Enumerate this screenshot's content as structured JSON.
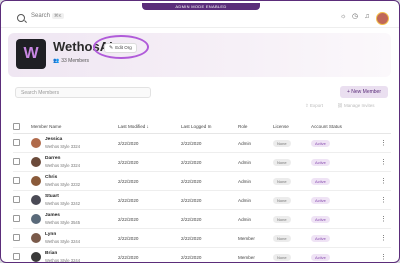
{
  "admin_badge": "ADMIN MODE ENABLED",
  "topbar": {
    "search_label": "Search",
    "search_shortcut": "⌘K",
    "icons": [
      "sun-icon",
      "clock-icon",
      "bell-icon",
      "avatar"
    ]
  },
  "org": {
    "name": "WethosAI",
    "edit_label": "Edit Org",
    "members_count": "33 Members",
    "logo_color": "#c987e3"
  },
  "search_members_placeholder": "Search Members",
  "new_member_label": "+ New Member",
  "export_label": "Export",
  "manage_invites_label": "Manage Invites",
  "table": {
    "headers": [
      "Member Name",
      "Last Modified",
      "Last Logged In",
      "Role",
      "License",
      "Account Status"
    ],
    "rows": [
      {
        "name": "Jessica",
        "subtitle": "Wethos Style 3324",
        "modified": "2/22/2020",
        "logged": "2/22/2020",
        "role": "Admin",
        "license": "None",
        "status": "Active",
        "avatar": "#b06a4a"
      },
      {
        "name": "Darren",
        "subtitle": "Wethos Style 3324",
        "modified": "2/22/2020",
        "logged": "2/22/2020",
        "role": "Admin",
        "license": "None",
        "status": "Active",
        "avatar": "#6b4a3a"
      },
      {
        "name": "Chris",
        "subtitle": "Wethos Style 3232",
        "modified": "2/22/2020",
        "logged": "2/22/2020",
        "role": "Admin",
        "license": "None",
        "status": "Active",
        "avatar": "#8a5a3a"
      },
      {
        "name": "Stuart",
        "subtitle": "Wethos Style 3242",
        "modified": "2/22/2020",
        "logged": "2/22/2020",
        "role": "Admin",
        "license": "None",
        "status": "Active",
        "avatar": "#4a4a55"
      },
      {
        "name": "James",
        "subtitle": "Wethos Style 3545",
        "modified": "2/22/2020",
        "logged": "2/22/2020",
        "role": "Admin",
        "license": "None",
        "status": "Active",
        "avatar": "#5a6a7a"
      },
      {
        "name": "Lynn",
        "subtitle": "Wethos Style 3244",
        "modified": "2/22/2020",
        "logged": "2/22/2020",
        "role": "Member",
        "license": "None",
        "status": "Active",
        "avatar": "#7a5a4a"
      },
      {
        "name": "Brian",
        "subtitle": "Wethos Style 3244",
        "modified": "2/22/2020",
        "logged": "2/22/2020",
        "role": "Member",
        "license": "None",
        "status": "Active",
        "avatar": "#3a3a3a"
      }
    ]
  }
}
